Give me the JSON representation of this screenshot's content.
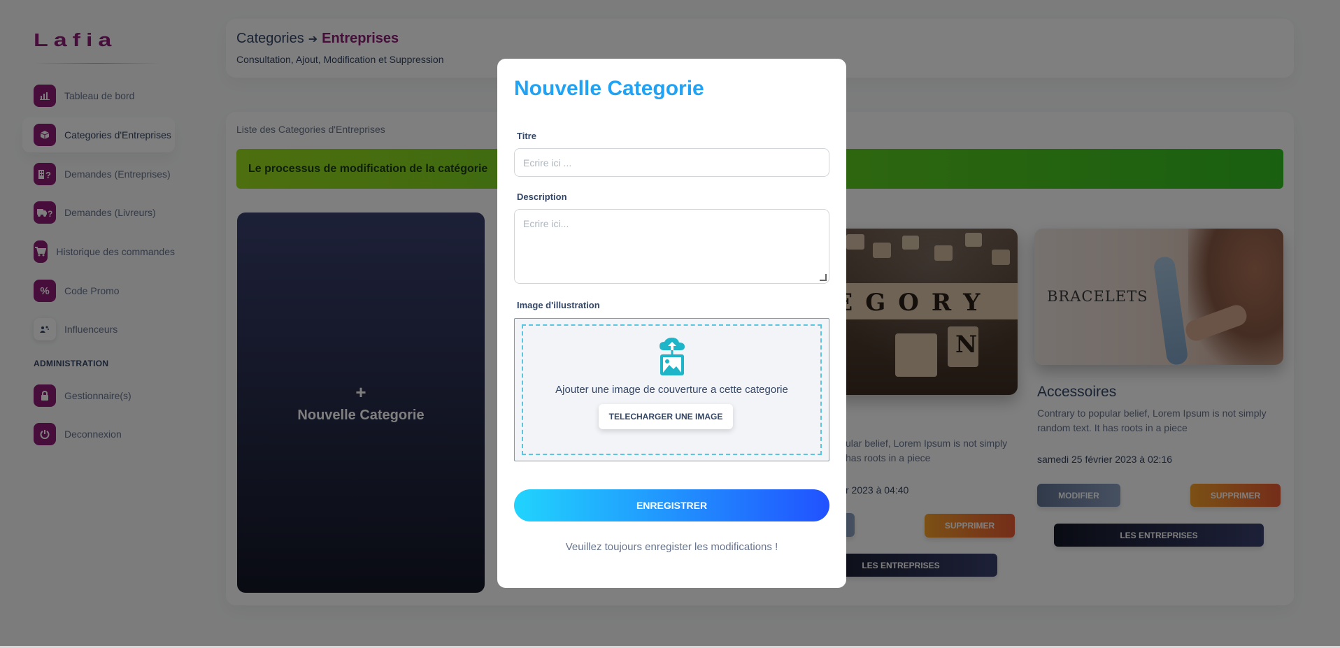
{
  "brand": {
    "logo_text": "Lafia",
    "accent": "#8e1b77"
  },
  "sidebar": {
    "items": [
      {
        "label": "Tableau de bord",
        "icon": "chart-icon"
      },
      {
        "label": "Categories d'Entreprises",
        "icon": "box-icon",
        "active": true
      },
      {
        "label": "Demandes (Entreprises)",
        "icon": "building-question-icon"
      },
      {
        "label": "Demandes (Livreurs)",
        "icon": "truck-question-icon"
      },
      {
        "label": "Historique des commandes",
        "icon": "cart-icon"
      },
      {
        "label": "Code Promo",
        "icon": "percent-icon"
      },
      {
        "label": "Influenceurs",
        "icon": "users-icon"
      }
    ],
    "admin_section_label": "ADMINISTRATION",
    "admin_items": [
      {
        "label": "Gestionnaire(s)",
        "icon": "lock-icon"
      },
      {
        "label": "Deconnexion",
        "icon": "power-icon"
      }
    ]
  },
  "header": {
    "breadcrumb_parent": "Categories",
    "breadcrumb_current": "Entreprises",
    "subtitle": "Consultation, Ajout, Modification et Suppression"
  },
  "main": {
    "list_title": "Liste des Categories d'Entreprises",
    "alert_text": "Le processus de modification de la catégorie",
    "new_card_label": "Nouvelle Categorie",
    "new_card_plus": "+",
    "cards": [
      {
        "image_text": "TEGORY",
        "image_letter": "N",
        "desc": "ular belief, Lorem Ipsum is not simply\nhas roots in a piece",
        "date": "r 2023 à 04:40",
        "modify": "",
        "delete": "SUPPRIMER",
        "companies": "LES ENTREPRISES"
      },
      {
        "image_text": "BRACELETS",
        "title": "Accessoires",
        "desc": "Contrary to popular belief, Lorem Ipsum is not simply random text. It has roots in a piece",
        "date": "samedi 25 février 2023 à 02:16",
        "modify": "MODIFIER",
        "delete": "SUPPRIMER",
        "companies": "LES ENTREPRISES"
      }
    ]
  },
  "modal": {
    "title": "Nouvelle Categorie",
    "title_label": "Titre",
    "title_placeholder": "Ecrire ici ...",
    "description_label": "Description",
    "description_placeholder": "Ecrire ici...",
    "image_label": "Image d'illustration",
    "drop_text": "Ajouter une image de couverture a cette categorie",
    "upload_button": "TELECHARGER UNE IMAGE",
    "save_button": "ENREGISTRER",
    "note": "Veuillez toujours enregister les modifications !"
  }
}
